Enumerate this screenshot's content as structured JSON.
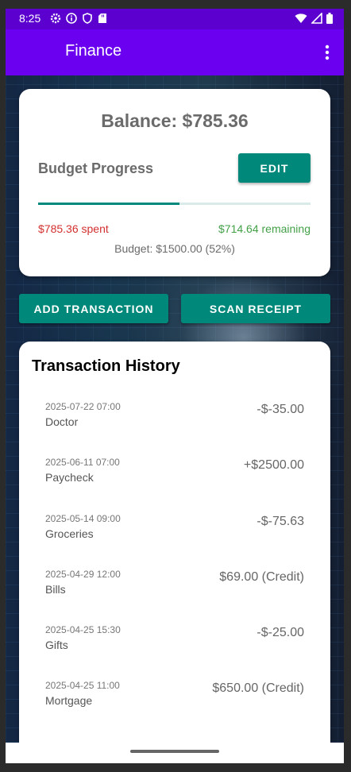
{
  "status_bar": {
    "time": "8:25",
    "left_icons": [
      "settings-gear-icon",
      "info-icon",
      "shield-icon",
      "sd-card-icon"
    ],
    "right_icons": [
      "wifi-icon",
      "signal-icon",
      "battery-icon"
    ]
  },
  "app_bar": {
    "title": "Finance",
    "menu_icon": "more-vert-icon",
    "color": "#6A00EF"
  },
  "balance_card": {
    "balance_text": "Balance: $785.36",
    "budget_label": "Budget Progress",
    "edit_label": "EDIT",
    "progress_fraction": 0.52,
    "spent_text": "$785.36 spent",
    "remaining_text": "$714.64 remaining",
    "budget_text": "Budget: $1500.00 (52%)",
    "accent_color": "#00897B",
    "spent_color": "#d32f2f",
    "remaining_color": "#43a047"
  },
  "actions": {
    "add_label": "ADD TRANSACTION",
    "scan_label": "SCAN RECEIPT"
  },
  "history": {
    "title": "Transaction History",
    "items": [
      {
        "date": "2025-07-22 07:00",
        "description": "Doctor",
        "amount": "-$-35.00"
      },
      {
        "date": "2025-06-11 07:00",
        "description": "Paycheck",
        "amount": "+$2500.00"
      },
      {
        "date": "2025-05-14 09:00",
        "description": "Groceries",
        "amount": "-$-75.63"
      },
      {
        "date": "2025-04-29 12:00",
        "description": "Bills",
        "amount": "$69.00 (Credit)"
      },
      {
        "date": "2025-04-25 15:30",
        "description": "Gifts",
        "amount": "-$-25.00"
      },
      {
        "date": "2025-04-25 11:00",
        "description": "Mortgage",
        "amount": "$650.00 (Credit)"
      }
    ]
  },
  "fab": {
    "icon": "star-outline-icon",
    "color": "#17D9C9"
  }
}
